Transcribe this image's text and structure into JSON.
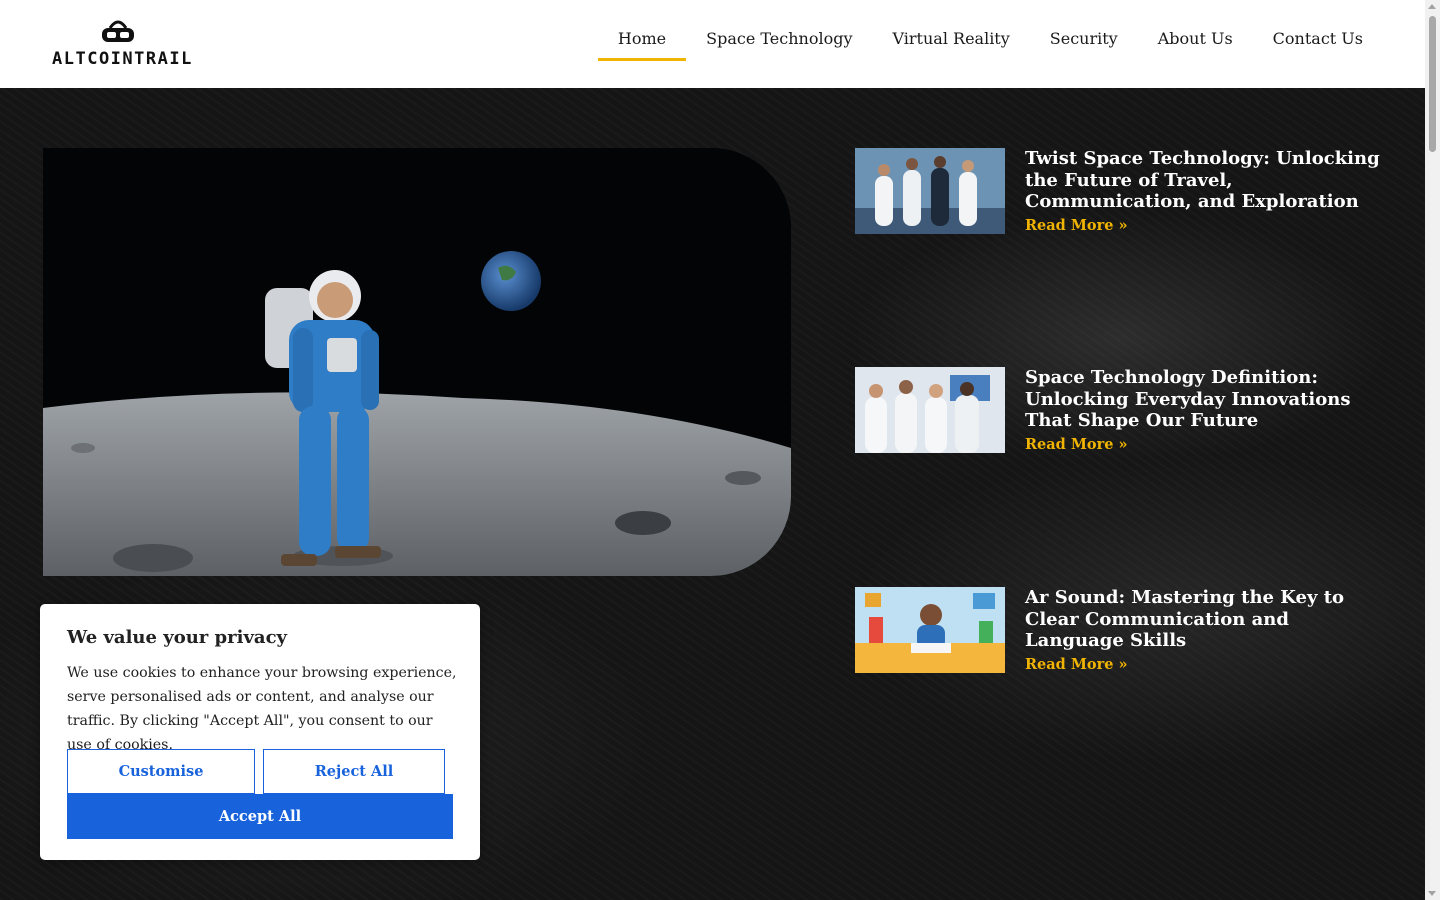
{
  "logo": {
    "text": "ALTCOINTRAIL",
    "icon": "vr-headset-icon"
  },
  "nav": {
    "items": [
      {
        "label": "Home",
        "active": true
      },
      {
        "label": "Space Technology",
        "active": false
      },
      {
        "label": "Virtual Reality",
        "active": false
      },
      {
        "label": "Security",
        "active": false
      },
      {
        "label": "About Us",
        "active": false
      },
      {
        "label": "Contact Us",
        "active": false
      }
    ]
  },
  "posts": [
    {
      "title": "Twist Space Technology: Unlocking the Future of Travel, Communication, and Exploration",
      "read_more": "Read More »"
    },
    {
      "title": "Space Technology Definition: Unlocking Everyday Innovations That Shape Our Future",
      "read_more": "Read More »"
    },
    {
      "title": "Ar Sound: Mastering the Key to Clear Communication and Language Skills",
      "read_more": "Read More »"
    }
  ],
  "cookie": {
    "title": "We value your privacy",
    "text": "We use cookies to enhance your browsing experience, serve personalised ads or content, and analyse our traffic. By clicking \"Accept All\", you consent to our use of cookies.",
    "customise": "Customise",
    "reject": "Reject All",
    "accept": "Accept All"
  },
  "colors": {
    "accent": "#f1b400",
    "cookie_button": "#1863dc",
    "background": "#151515"
  }
}
